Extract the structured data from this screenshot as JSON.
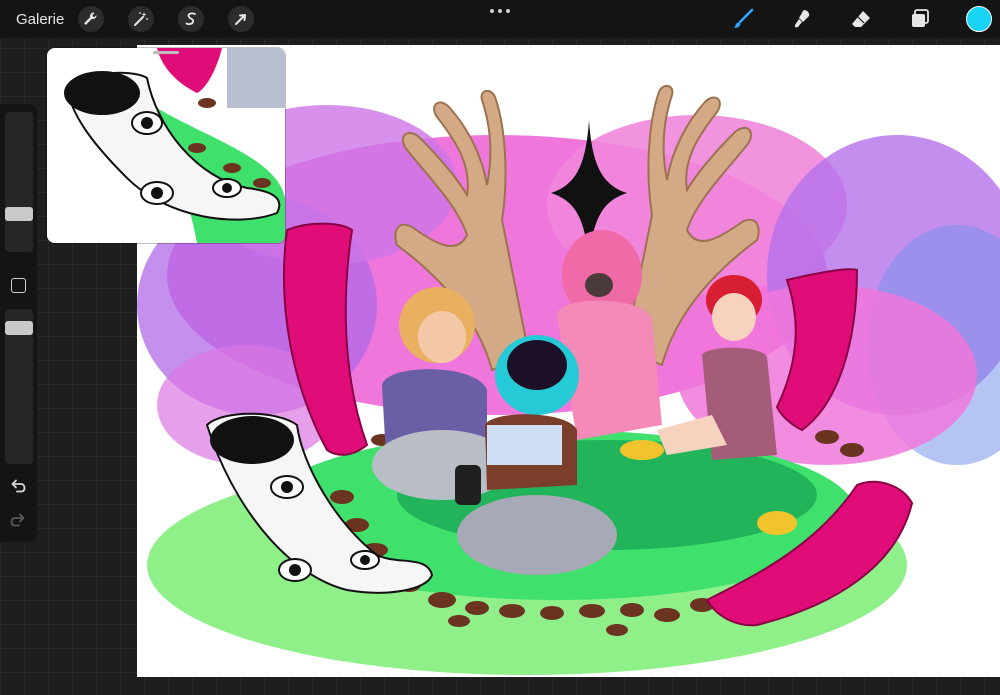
{
  "topbar": {
    "gallery_label": "Galerie",
    "left_tools": [
      {
        "name": "actions",
        "icon": "wrench-icon"
      },
      {
        "name": "adjustments",
        "icon": "magic-wand-icon"
      },
      {
        "name": "selection",
        "icon": "selection-s-icon"
      },
      {
        "name": "transform",
        "icon": "arrow-cursor-icon"
      }
    ],
    "more_icon": "ellipsis-icon",
    "right_tools": [
      {
        "name": "brush",
        "icon": "brush-icon",
        "active": true
      },
      {
        "name": "smudge",
        "icon": "smudge-icon",
        "active": false
      },
      {
        "name": "eraser",
        "icon": "eraser-icon",
        "active": false
      },
      {
        "name": "layers",
        "icon": "layers-icon",
        "active": false
      }
    ],
    "current_color": "#19d3f5",
    "active_tool_color": "#2fa7ff"
  },
  "sidebar": {
    "brush_size_icon": "size-slider",
    "opacity_icon": "opacity-slider",
    "modify_icon": "square-icon",
    "undo_icon": "undo-icon",
    "redo_icon": "redo-icon"
  },
  "canvas": {
    "colors": {
      "background": "#ffffff",
      "cloud_pink": "#ee69d8",
      "cloud_purple": "#a85ae6",
      "grass": "#3fe06b",
      "grass_dark": "#22b45a",
      "grass_light": "#8ff08a",
      "antler": "#d4aa86",
      "horn_magenta": "#e00c78",
      "tentacle_white": "#f6f6f6",
      "star": "#111111",
      "mushroom": "#6b3420"
    }
  },
  "reference_window": {
    "grab_handle_icon": "grab-handle"
  }
}
